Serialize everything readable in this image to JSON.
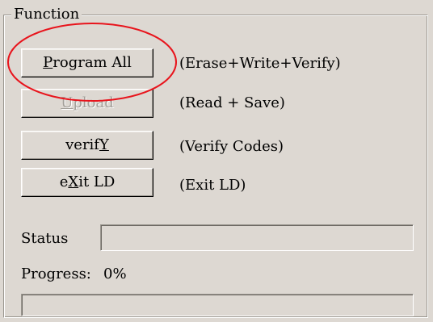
{
  "group": {
    "title": "Function"
  },
  "buttons": {
    "program_all": {
      "label": "Program All",
      "description": "(Erase+Write+Verify)"
    },
    "upload": {
      "label": "Upload",
      "description": "(Read + Save)",
      "enabled": false
    },
    "verify": {
      "label_pre": "verif",
      "label_accel": "Y",
      "description": "(Verify Codes)"
    },
    "exit": {
      "label_pre": "e",
      "label_accel": "X",
      "label_post": "it LD",
      "description": "(Exit LD)"
    }
  },
  "status": {
    "label": "Status",
    "value": ""
  },
  "progress": {
    "label": "Progress:",
    "percent_text": "0%",
    "fraction": 0
  },
  "annotation": {
    "color": "#e8141c"
  }
}
